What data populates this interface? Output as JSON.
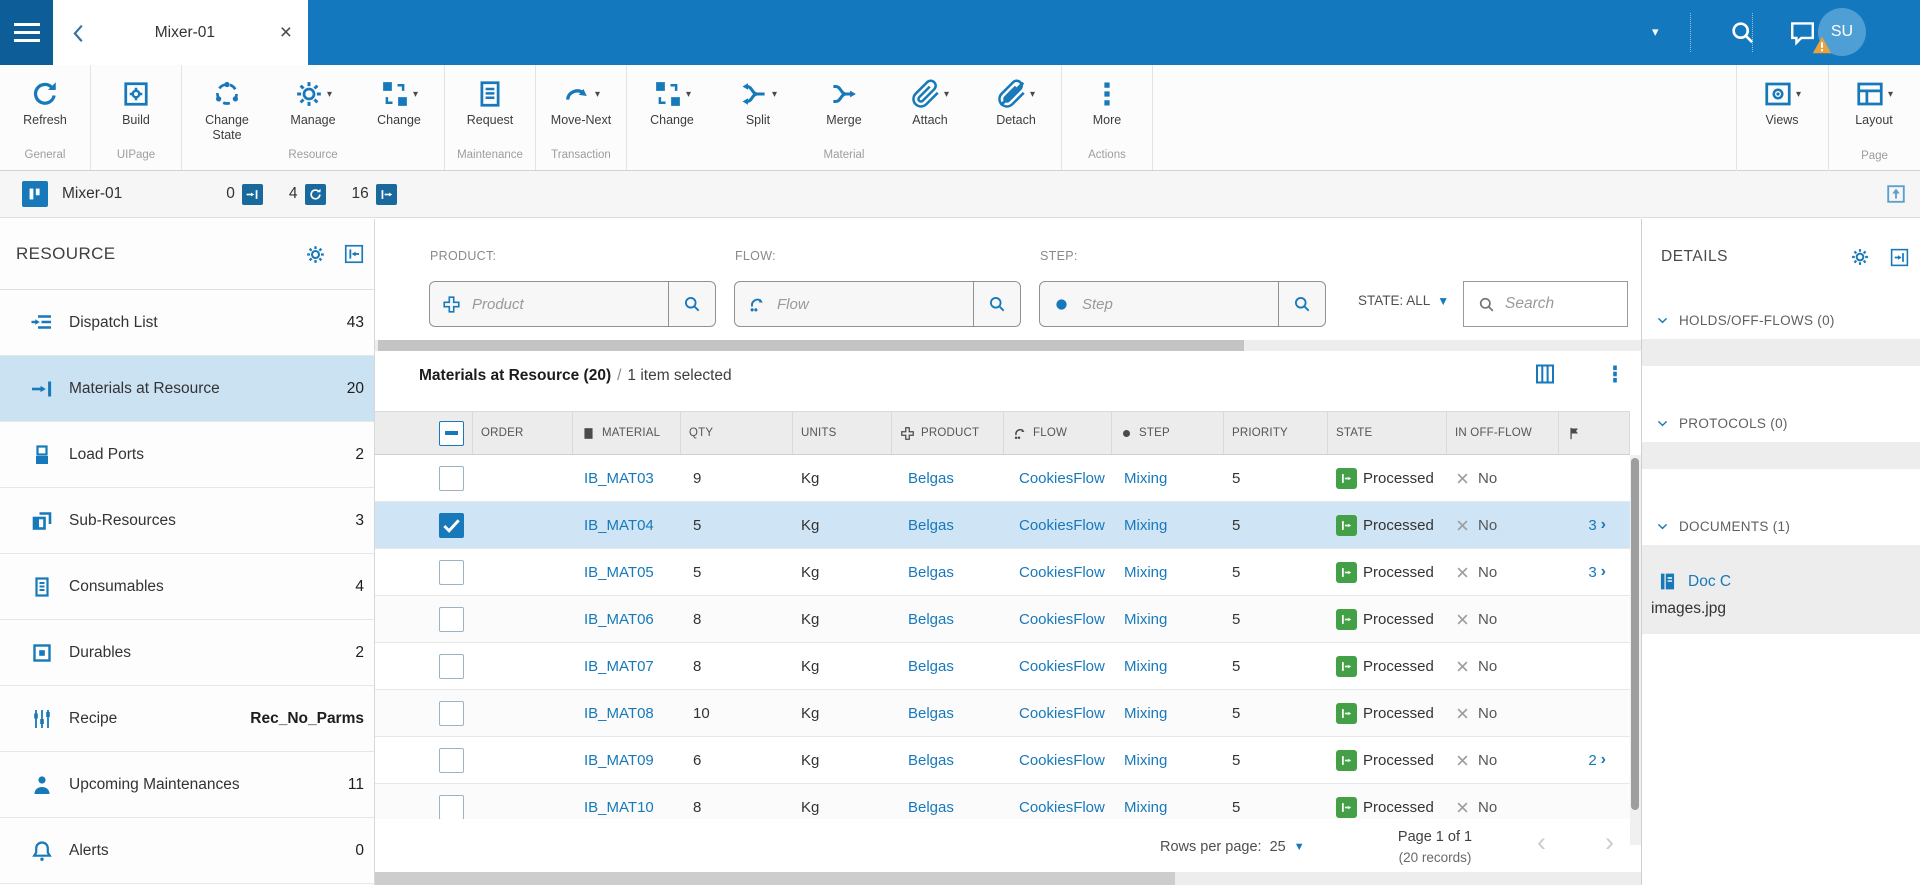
{
  "topbar": {
    "tab_title": "Mixer-01",
    "avatar_initials": "SU"
  },
  "ribbon": {
    "groups": [
      {
        "label": "General",
        "buttons": [
          {
            "label": "Refresh",
            "icon": "refresh-icon",
            "dropdown": false
          }
        ]
      },
      {
        "label": "UIPage",
        "buttons": [
          {
            "label": "Build",
            "icon": "build-icon",
            "dropdown": false
          }
        ]
      },
      {
        "label": "Resource",
        "buttons": [
          {
            "label": "Change State",
            "icon": "change-state-icon",
            "dropdown": false
          },
          {
            "label": "Manage",
            "icon": "manage-icon",
            "dropdown": true
          },
          {
            "label": "Change",
            "icon": "change-squares-icon",
            "dropdown": true
          }
        ]
      },
      {
        "label": "Maintenance",
        "buttons": [
          {
            "label": "Request",
            "icon": "request-icon",
            "dropdown": false
          }
        ]
      },
      {
        "label": "Transaction",
        "buttons": [
          {
            "label": "Move-Next",
            "icon": "move-next-icon",
            "dropdown": true
          }
        ]
      },
      {
        "label": "Material",
        "buttons": [
          {
            "label": "Change",
            "icon": "change-squares-icon",
            "dropdown": true
          },
          {
            "label": "Split",
            "icon": "split-icon",
            "dropdown": true
          },
          {
            "label": "Merge",
            "icon": "merge-icon",
            "dropdown": false
          },
          {
            "label": "Attach",
            "icon": "attach-icon",
            "dropdown": true
          },
          {
            "label": "Detach",
            "icon": "detach-icon",
            "dropdown": true
          }
        ]
      },
      {
        "label": "Actions",
        "buttons": [
          {
            "label": "More",
            "icon": "more-icon",
            "dropdown": false
          }
        ]
      }
    ],
    "right_groups": [
      {
        "label": "",
        "buttons": [
          {
            "label": "Views",
            "icon": "views-icon",
            "dropdown": true
          }
        ]
      },
      {
        "label": "Page",
        "buttons": [
          {
            "label": "Layout",
            "icon": "layout-icon",
            "dropdown": true
          }
        ]
      }
    ]
  },
  "statusbar": {
    "resource_name": "Mixer-01",
    "counts": [
      {
        "icon": "track-in-icon",
        "value": "0"
      },
      {
        "icon": "in-process-icon",
        "value": "4"
      },
      {
        "icon": "track-out-icon",
        "value": "16"
      }
    ]
  },
  "sidebar": {
    "title": "RESOURCE",
    "items": [
      {
        "label": "Dispatch List",
        "badge": "43",
        "icon": "dispatch-list-icon",
        "selected": false,
        "badge_bold": false
      },
      {
        "label": "Materials at Resource",
        "badge": "20",
        "icon": "materials-at-resource-icon",
        "selected": true,
        "badge_bold": false
      },
      {
        "label": "Load Ports",
        "badge": "2",
        "icon": "load-ports-icon",
        "selected": false,
        "badge_bold": false
      },
      {
        "label": "Sub-Resources",
        "badge": "3",
        "icon": "sub-resources-icon",
        "selected": false,
        "badge_bold": false
      },
      {
        "label": "Consumables",
        "badge": "4",
        "icon": "consumables-icon",
        "selected": false,
        "badge_bold": false
      },
      {
        "label": "Durables",
        "badge": "2",
        "icon": "durables-icon",
        "selected": false,
        "badge_bold": false
      },
      {
        "label": "Recipe",
        "badge": "Rec_No_Parms",
        "icon": "recipe-icon",
        "selected": false,
        "badge_bold": true
      },
      {
        "label": "Upcoming Maintenances",
        "badge": "11",
        "icon": "maintenances-icon",
        "selected": false,
        "badge_bold": false
      },
      {
        "label": "Alerts",
        "badge": "0",
        "icon": "alerts-icon",
        "selected": false,
        "badge_bold": false
      }
    ]
  },
  "filters": {
    "product_label": "PRODUCT:",
    "product_placeholder": "Product",
    "flow_label": "FLOW:",
    "flow_placeholder": "Flow",
    "step_label": "STEP:",
    "step_placeholder": "Step",
    "state_filter_label": "STATE: ALL",
    "search_placeholder": "Search"
  },
  "table": {
    "title": "Materials at Resource (20)",
    "separator": "/",
    "selection_info": "1 item selected",
    "columns": [
      "ORDER",
      "MATERIAL",
      "QTY",
      "UNITS",
      "PRODUCT",
      "FLOW",
      "STEP",
      "PRIORITY",
      "STATE",
      "IN OFF-FLOW"
    ],
    "rows": [
      {
        "material": "IB_MAT03",
        "qty": "9",
        "units": "Kg",
        "product": "Belgas",
        "flow": "CookiesFlow",
        "step": "Mixing",
        "priority": "5",
        "state": "Processed",
        "in_off_flow": "No",
        "docs": "",
        "selected": false
      },
      {
        "material": "IB_MAT04",
        "qty": "5",
        "units": "Kg",
        "product": "Belgas",
        "flow": "CookiesFlow",
        "step": "Mixing",
        "priority": "5",
        "state": "Processed",
        "in_off_flow": "No",
        "docs": "3",
        "selected": true
      },
      {
        "material": "IB_MAT05",
        "qty": "5",
        "units": "Kg",
        "product": "Belgas",
        "flow": "CookiesFlow",
        "step": "Mixing",
        "priority": "5",
        "state": "Processed",
        "in_off_flow": "No",
        "docs": "3",
        "selected": false
      },
      {
        "material": "IB_MAT06",
        "qty": "8",
        "units": "Kg",
        "product": "Belgas",
        "flow": "CookiesFlow",
        "step": "Mixing",
        "priority": "5",
        "state": "Processed",
        "in_off_flow": "No",
        "docs": "",
        "selected": false
      },
      {
        "material": "IB_MAT07",
        "qty": "8",
        "units": "Kg",
        "product": "Belgas",
        "flow": "CookiesFlow",
        "step": "Mixing",
        "priority": "5",
        "state": "Processed",
        "in_off_flow": "No",
        "docs": "",
        "selected": false
      },
      {
        "material": "IB_MAT08",
        "qty": "10",
        "units": "Kg",
        "product": "Belgas",
        "flow": "CookiesFlow",
        "step": "Mixing",
        "priority": "5",
        "state": "Processed",
        "in_off_flow": "No",
        "docs": "",
        "selected": false
      },
      {
        "material": "IB_MAT09",
        "qty": "6",
        "units": "Kg",
        "product": "Belgas",
        "flow": "CookiesFlow",
        "step": "Mixing",
        "priority": "5",
        "state": "Processed",
        "in_off_flow": "No",
        "docs": "2",
        "selected": false
      },
      {
        "material": "IB_MAT10",
        "qty": "8",
        "units": "Kg",
        "product": "Belgas",
        "flow": "CookiesFlow",
        "step": "Mixing",
        "priority": "5",
        "state": "Processed",
        "in_off_flow": "No",
        "docs": "",
        "selected": false
      }
    ],
    "footer": {
      "rows_per_page_label": "Rows per page:",
      "rows_per_page_value": "25",
      "page_info": "Page 1 of 1",
      "records_info": "(20 records)"
    }
  },
  "details": {
    "title": "DETAILS",
    "sections": [
      {
        "label": "HOLDS/OFF-FLOWS (0)"
      },
      {
        "label": "PROTOCOLS (0)"
      },
      {
        "label": "DOCUMENTS (1)"
      }
    ],
    "document": {
      "name": "Doc C",
      "file": "images.jpg"
    }
  },
  "colors": {
    "primary": "#1779ba",
    "topbar": "#1478be",
    "selected_row": "#cfe4f4",
    "state_green": "#43a047",
    "warning": "#e8a33d"
  }
}
